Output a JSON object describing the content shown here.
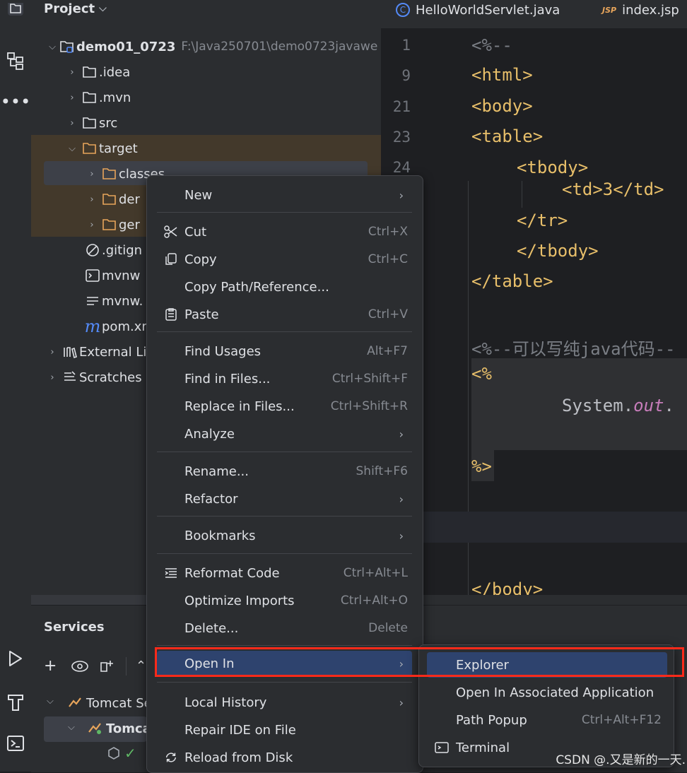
{
  "project_panel": {
    "title": "Project",
    "tree": [
      {
        "label": "demo01_0723",
        "path": "F:\\Java250701\\demo0723javawe",
        "icon": "module-folder-icon"
      },
      {
        "label": ".idea",
        "icon": "folder-icon"
      },
      {
        "label": ".mvn",
        "icon": "folder-icon"
      },
      {
        "label": "src",
        "icon": "folder-icon"
      },
      {
        "label": "target",
        "icon": "excluded-folder-icon"
      },
      {
        "label": "classes",
        "icon": "excluded-folder-icon"
      },
      {
        "label": "der",
        "icon": "excluded-folder-icon"
      },
      {
        "label": "ger",
        "icon": "excluded-folder-icon"
      },
      {
        "label": ".gitign",
        "icon": "ignore-file-icon"
      },
      {
        "label": "mvnw",
        "icon": "shell-file-icon"
      },
      {
        "label": "mvnw.",
        "icon": "text-file-icon"
      },
      {
        "label": "pom.xr",
        "icon": "maven-icon"
      },
      {
        "label": "External Li",
        "icon": "library-icon"
      },
      {
        "label": "Scratches",
        "icon": "scratches-icon"
      }
    ]
  },
  "editor": {
    "tabs": [
      {
        "label": "HelloWorldServlet.java",
        "badge": "C"
      },
      {
        "label": "index.jsp",
        "badge": "JSP"
      }
    ],
    "line_numbers": [
      "1",
      "9",
      "21",
      "23",
      "24"
    ],
    "lines": {
      "l1": "<%--",
      "l2": "<html>",
      "l3": "<body>",
      "l4": "<table>",
      "l5": "<tbody>",
      "l6": "<td>3</td>",
      "l7": "</tr>",
      "l8": "</tbody>",
      "l9": "</table>",
      "l10": "<%--可以写纯java代码--",
      "l11": "<%",
      "l12a": "System.",
      "l12b": "out",
      "l12c": ".",
      "l13": "%>",
      "l14": "</body>"
    }
  },
  "services": {
    "title": "Services",
    "items": [
      {
        "label": "Tomcat Se"
      },
      {
        "label": "Tomca"
      }
    ]
  },
  "context_menu": {
    "items": {
      "new": {
        "label": "New"
      },
      "cut": {
        "label": "Cut",
        "shortcut": "Ctrl+X"
      },
      "copy": {
        "label": "Copy",
        "shortcut": "Ctrl+C"
      },
      "copy_path": {
        "label": "Copy Path/Reference..."
      },
      "paste": {
        "label": "Paste",
        "shortcut": "Ctrl+V"
      },
      "find_usages": {
        "label": "Find Usages",
        "shortcut": "Alt+F7"
      },
      "find_in_files": {
        "label": "Find in Files...",
        "shortcut": "Ctrl+Shift+F"
      },
      "replace_in_files": {
        "label": "Replace in Files...",
        "shortcut": "Ctrl+Shift+R"
      },
      "analyze": {
        "label": "Analyze"
      },
      "rename": {
        "label": "Rename...",
        "shortcut": "Shift+F6"
      },
      "refactor": {
        "label": "Refactor"
      },
      "bookmarks": {
        "label": "Bookmarks"
      },
      "reformat": {
        "label": "Reformat Code",
        "shortcut": "Ctrl+Alt+L"
      },
      "optimize": {
        "label": "Optimize Imports",
        "shortcut": "Ctrl+Alt+O"
      },
      "delete": {
        "label": "Delete...",
        "shortcut": "Delete"
      },
      "open_in": {
        "label": "Open In"
      },
      "local_history": {
        "label": "Local History"
      },
      "repair": {
        "label": "Repair IDE on File"
      },
      "reload": {
        "label": "Reload from Disk"
      }
    }
  },
  "submenu": {
    "items": {
      "explorer": {
        "label": "Explorer"
      },
      "associated": {
        "label": "Open In Associated Application"
      },
      "path_popup": {
        "label": "Path Popup",
        "shortcut": "Ctrl+Alt+F12"
      },
      "terminal": {
        "label": "Terminal"
      }
    }
  },
  "watermark": "CSDN @.又是新的一天.",
  "colors": {
    "selection": "#2e436e",
    "highlight_box": "#ff2a1a",
    "excluded_folder": "#e8a55b"
  }
}
